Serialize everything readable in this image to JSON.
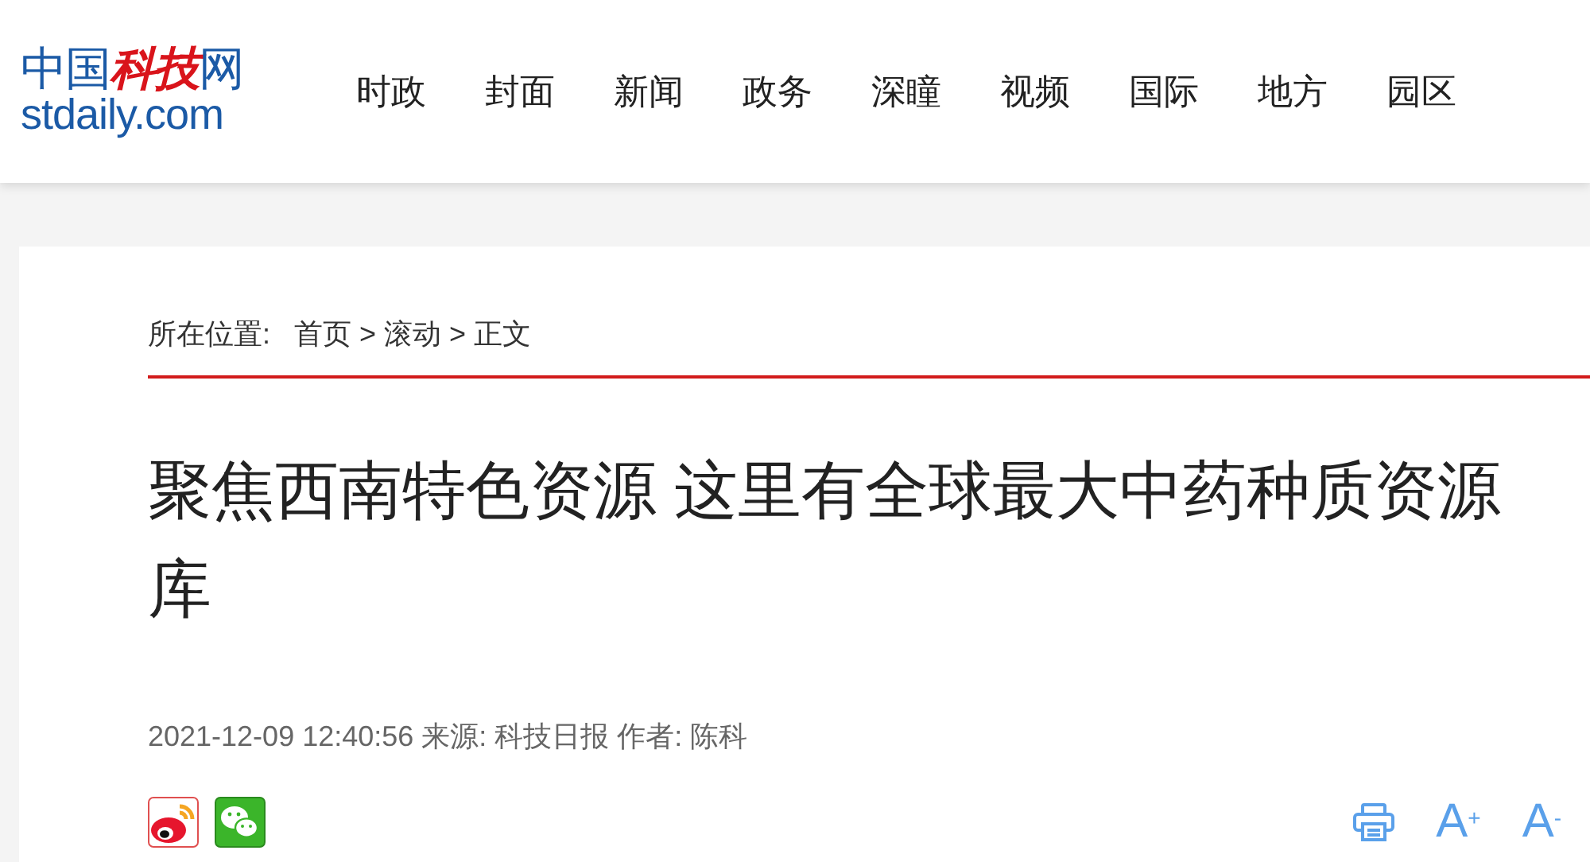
{
  "logo": {
    "name": "中国科技网",
    "domain": "stdaily.com"
  },
  "nav": [
    "时政",
    "封面",
    "新闻",
    "政务",
    "深瞳",
    "视频",
    "国际",
    "地方",
    "园区"
  ],
  "breadcrumb": {
    "label": "所在位置:",
    "items": [
      "首页",
      "滚动",
      "正文"
    ],
    "separator": ">"
  },
  "article": {
    "title": "聚焦西南特色资源 这里有全球最大中药种质资源库",
    "meta": "2021-12-09 12:40:56 来源: 科技日报 作者: 陈科"
  },
  "share": [
    {
      "kind": "weibo"
    },
    {
      "kind": "wechat"
    }
  ],
  "tools": [
    {
      "kind": "print"
    },
    {
      "kind": "font",
      "label": "A",
      "sign": "+"
    },
    {
      "kind": "font",
      "label": "A",
      "sign": "-"
    }
  ]
}
